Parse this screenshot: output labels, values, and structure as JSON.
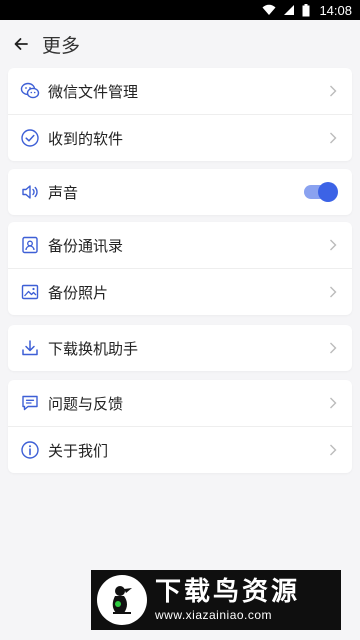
{
  "status_bar": {
    "time": "14:08",
    "icons": [
      "wifi-icon",
      "signal-icon",
      "battery-icon"
    ]
  },
  "header": {
    "title": "更多",
    "back_icon": "arrow-left-icon"
  },
  "groups": [
    {
      "items": [
        {
          "label": "微信文件管理",
          "icon": "wechat-icon"
        },
        {
          "label": "收到的软件",
          "icon": "check-circle-icon"
        }
      ]
    },
    {
      "items": [
        {
          "label": "声音",
          "icon": "speaker-icon",
          "toggle": true
        }
      ]
    },
    {
      "items": [
        {
          "label": "备份通讯录",
          "icon": "contacts-icon"
        },
        {
          "label": "备份照片",
          "icon": "photo-icon"
        }
      ]
    },
    {
      "items": [
        {
          "label": "下载换机助手",
          "icon": "download-icon"
        }
      ]
    },
    {
      "items": [
        {
          "label": "问题与反馈",
          "icon": "feedback-icon"
        },
        {
          "label": "关于我们",
          "icon": "info-icon"
        }
      ]
    }
  ],
  "colors": {
    "accent": "#3c63e6",
    "icon": "#3d5fd6",
    "background": "#f5f5f7"
  },
  "watermark": {
    "title": "下载鸟资源",
    "url": "www.xiazainiao.com"
  }
}
